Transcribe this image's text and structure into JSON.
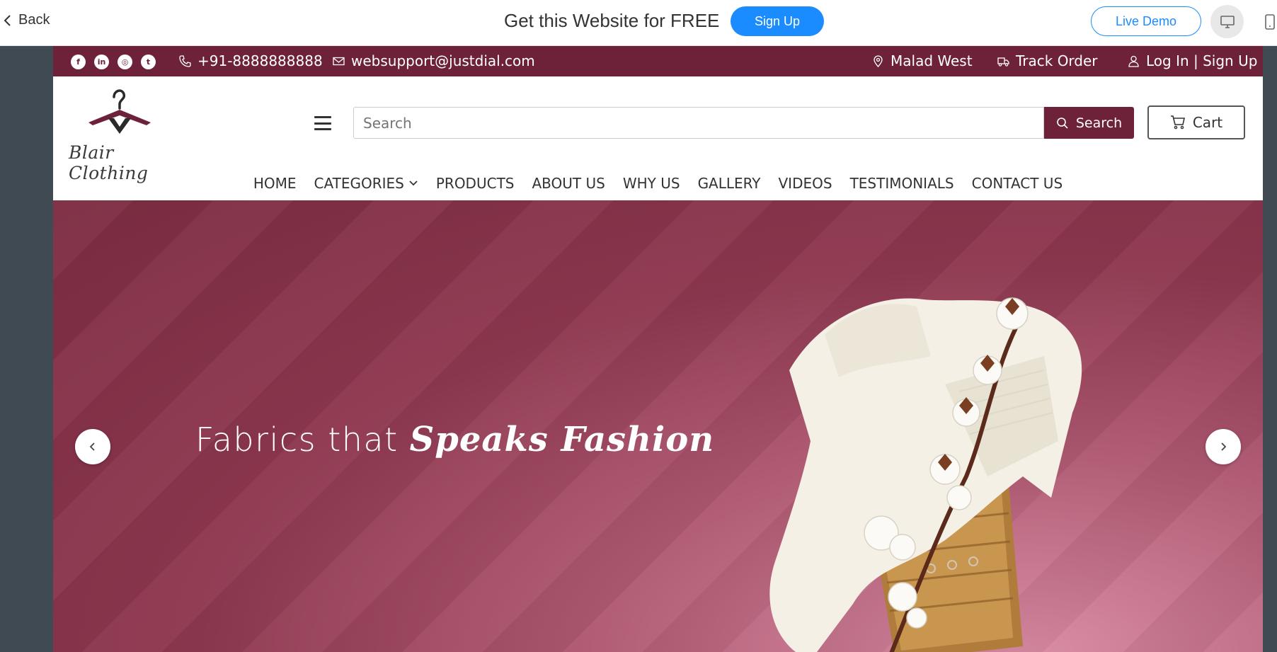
{
  "builder": {
    "back_label": "Back",
    "promo_text": "Get this Website for FREE",
    "signup_label": "Sign Up",
    "live_demo_label": "Live Demo",
    "desktop_icon": "desktop-icon",
    "mobile_icon": "mobile-icon",
    "accent_color": "#1a8cff"
  },
  "topbar": {
    "socials": [
      {
        "name": "facebook-icon",
        "glyph": "f"
      },
      {
        "name": "linkedin-icon",
        "glyph": "in"
      },
      {
        "name": "instagram-icon",
        "glyph": "◎"
      },
      {
        "name": "twitter-icon",
        "glyph": "t"
      }
    ],
    "phone": "+91-8888888888",
    "email": "websupport@justdial.com",
    "location": "Malad West",
    "track_order": "Track Order",
    "login": "Log In | Sign Up",
    "bg_color": "#6d2239"
  },
  "header": {
    "logo_text": "Blair Clothing",
    "search_placeholder": "Search",
    "search_button": "Search",
    "cart_label": "Cart"
  },
  "nav": {
    "items": [
      "HOME",
      "CATEGORIES",
      "PRODUCTS",
      "ABOUT US",
      "WHY US",
      "GALLERY",
      "VIDEOS",
      "TESTIMONIALS",
      "CONTACT US"
    ]
  },
  "hero": {
    "title_plain": "Fabrics that",
    "title_script": "Speaks Fashion"
  }
}
